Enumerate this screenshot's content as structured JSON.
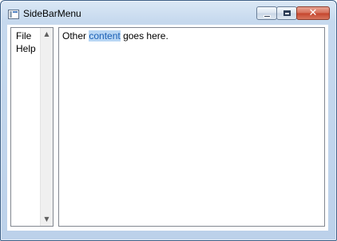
{
  "window": {
    "title": "SideBarMenu",
    "caption_buttons": {
      "minimize_icon": "minimize-icon",
      "maximize_icon": "maximize-icon",
      "close_icon": "close-icon",
      "close_glyph": "✕"
    }
  },
  "sidebar": {
    "items": [
      {
        "label": "File"
      },
      {
        "label": "Help"
      }
    ],
    "scroll_up_glyph": "▲",
    "scroll_down_glyph": "▼"
  },
  "content": {
    "text_before": "Other ",
    "highlighted": "content",
    "text_after": " goes here."
  },
  "colors": {
    "highlight_bg": "#b8d6f4",
    "highlight_text": "#1a5fb4",
    "close_button": "#c5452c"
  }
}
